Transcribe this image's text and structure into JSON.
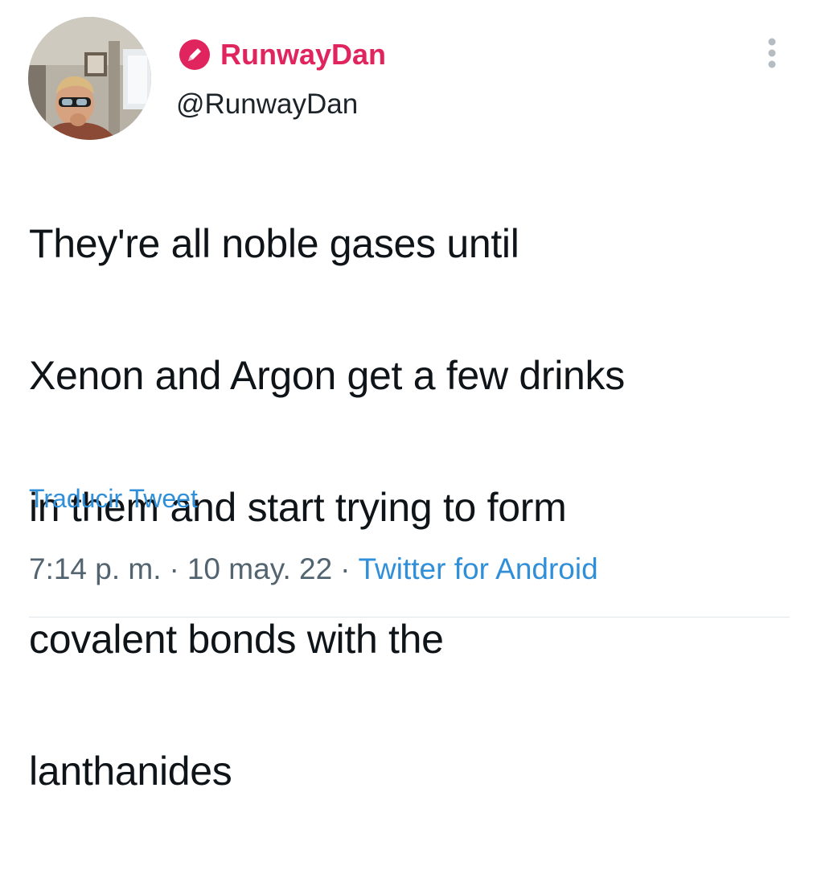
{
  "tweet": {
    "display_name": "RunwayDan",
    "handle": "@RunwayDan",
    "text_lines": [
      "They're all noble gases until",
      "Xenon and Argon get a few drinks",
      "in them and start trying to form",
      "covalent bonds with the",
      "lanthanides"
    ],
    "translate_label": "Traducir Tweet",
    "time": "7:14 p. m.",
    "separator": "·",
    "date": "10 may. 22",
    "source": "Twitter for Android"
  },
  "icons": {
    "badge": "pencil-badge-icon",
    "more": "more-vertical-icon"
  },
  "colors": {
    "display_name": "#e0245e",
    "link": "#2f8fd8",
    "secondary_text": "#536471"
  }
}
